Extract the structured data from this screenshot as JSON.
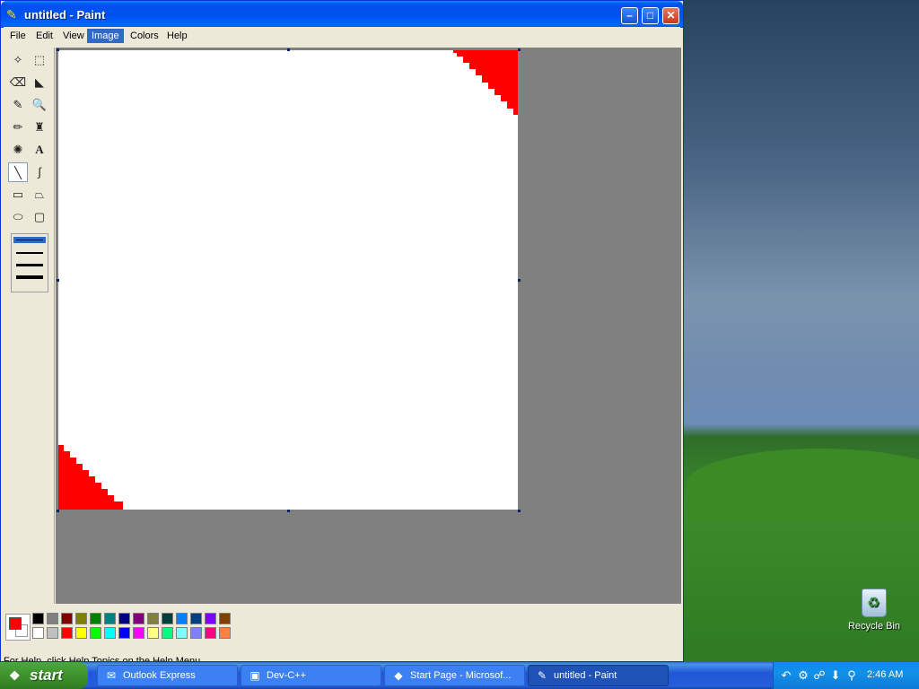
{
  "window": {
    "title": "untitled - Paint",
    "buttons": {
      "minimize": "–",
      "maximize": "□",
      "close": "✕"
    }
  },
  "menu": [
    "File",
    "Edit",
    "View",
    "Image",
    "Colors",
    "Help"
  ],
  "active_menu": "Image",
  "tools": [
    {
      "name": "free-form-select",
      "icon": "✧"
    },
    {
      "name": "rect-select",
      "icon": "⬚"
    },
    {
      "name": "eraser",
      "icon": "⌫"
    },
    {
      "name": "fill-bucket",
      "icon": "◣"
    },
    {
      "name": "pick-color",
      "icon": "✎"
    },
    {
      "name": "magnifier",
      "icon": "🔍"
    },
    {
      "name": "pencil",
      "icon": "✏"
    },
    {
      "name": "brush",
      "icon": "♜"
    },
    {
      "name": "airbrush",
      "icon": "✺"
    },
    {
      "name": "text",
      "icon": "A"
    },
    {
      "name": "line",
      "icon": "╲"
    },
    {
      "name": "curve",
      "icon": "∫"
    },
    {
      "name": "rectangle",
      "icon": "▭"
    },
    {
      "name": "polygon",
      "icon": "⏢"
    },
    {
      "name": "ellipse",
      "icon": "⬭"
    },
    {
      "name": "rounded-rectangle",
      "icon": "▢"
    }
  ],
  "selected_tool": "line",
  "palette": {
    "foreground": "#ff0000",
    "background": "#ffffff",
    "colors_top": [
      "#000000",
      "#808080",
      "#800000",
      "#808000",
      "#008000",
      "#008080",
      "#000080",
      "#800080",
      "#808040",
      "#004040",
      "#0080ff",
      "#004080",
      "#8000ff",
      "#804000"
    ],
    "colors_bottom": [
      "#ffffff",
      "#c0c0c0",
      "#ff0000",
      "#ffff00",
      "#00ff00",
      "#00ffff",
      "#0000ff",
      "#ff00ff",
      "#ffff80",
      "#00ff80",
      "#80ffff",
      "#8080ff",
      "#ff0080",
      "#ff8040"
    ]
  },
  "status": "For Help, click Help Topics on the Help Menu.",
  "desktop": {
    "recycle_bin": "Recycle Bin"
  },
  "taskbar": {
    "start": "start",
    "tasks": [
      {
        "label": "Outlook Express",
        "icon": "✉"
      },
      {
        "label": "Dev-C++",
        "icon": "▣"
      },
      {
        "label": "Start Page - Microsof...",
        "icon": "◆"
      },
      {
        "label": "untitled - Paint",
        "icon": "✎"
      }
    ],
    "clock": "2:46 AM"
  }
}
